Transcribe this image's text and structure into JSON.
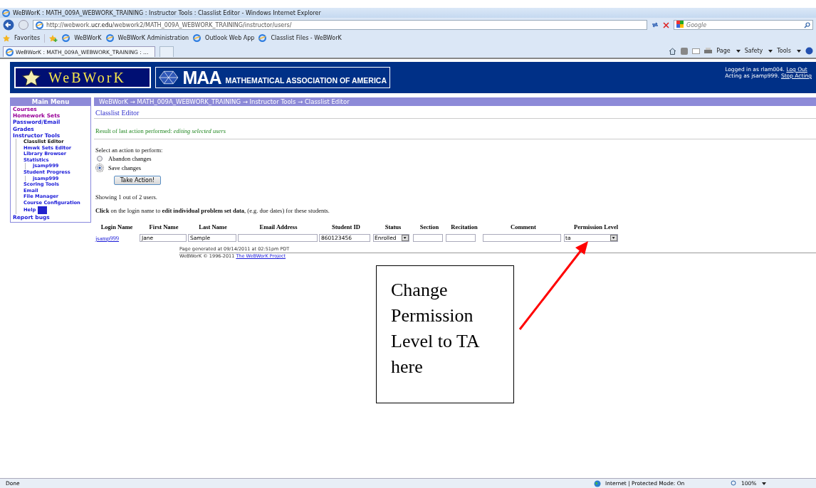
{
  "window": {
    "title": "WeBWorK : MATH_009A_WEBWORK_TRAINING : Instructor Tools : Classlist Editor - Windows Internet Explorer"
  },
  "address_bar": {
    "url_prefix": "http://webwork.",
    "url_host": "ucr.edu",
    "url_path": "/webwork2/MATH_009A_WEBWORK_TRAINING/instructor/users/",
    "search_placeholder": "Google"
  },
  "favorites": {
    "label": "Favorites",
    "links": [
      "WeBWorK",
      "WeBWorK Administration",
      "Outlook Web App",
      "Classlist Files - WeBWorK"
    ]
  },
  "tabs": [
    {
      "label": "WeBWorK : MATH_009A_WEBWORK_TRAINING : ...",
      "selected": true
    }
  ],
  "command_bar": [
    "Page",
    "Safety",
    "Tools"
  ],
  "banner": {
    "logo": "WeBWorK",
    "maa": "MAA",
    "maa_name": "MATHEMATICAL ASSOCIATION OF AMERICA",
    "login_text": "Logged in as rlam004.",
    "logout": "Log Out",
    "acting_text": "Acting as jsamp999.",
    "stop_acting": "Stop Acting"
  },
  "menu": {
    "title": "Main Menu",
    "items": [
      {
        "label": "Courses",
        "visited": true,
        "selected": false
      },
      {
        "label": "Homework Sets",
        "visited": true,
        "selected": false
      },
      {
        "label": "Password/Email",
        "visited": false,
        "selected": false
      },
      {
        "label": "Grades",
        "visited": false,
        "selected": false
      },
      {
        "label": "Instructor Tools",
        "visited": false,
        "selected": false,
        "children": [
          {
            "label": "Classlist Editor",
            "visited": false,
            "selected": true
          },
          {
            "label": "Hmwk Sets Editor",
            "visited": false,
            "selected": false
          },
          {
            "label": "Library Browser",
            "visited": false,
            "selected": false
          },
          {
            "label": "Statistics",
            "visited": false,
            "selected": false,
            "children": [
              {
                "label": "jsamp999",
                "visited": false,
                "selected": false
              }
            ]
          },
          {
            "label": "Student Progress",
            "visited": false,
            "selected": false,
            "children": [
              {
                "label": "jsamp999",
                "visited": false,
                "selected": false
              }
            ]
          },
          {
            "label": "Scoring Tools",
            "visited": false,
            "selected": false
          },
          {
            "label": "Email",
            "visited": false,
            "selected": false
          },
          {
            "label": "File Manager",
            "visited": false,
            "selected": false
          },
          {
            "label": "Course Configuration",
            "visited": false,
            "selected": false
          },
          {
            "label": "Help",
            "kind": "help",
            "visited": false,
            "selected": false
          }
        ]
      },
      {
        "label": "Report bugs",
        "visited": false,
        "selected": false
      }
    ]
  },
  "breadcrumb": "WeBWorK → MATH_009A_WEBWORK_TRAINING → Instructor Tools → Classlist Editor",
  "page_title": "Classlist Editor",
  "result_message": "Result of last action performed: *editing selected users*",
  "action": {
    "prompt": "Select an action to perform:",
    "options": [
      {
        "label": "Abandon changes",
        "selected": false
      },
      {
        "label": "Save changes",
        "selected": true
      }
    ],
    "button": "Take Action!"
  },
  "showing": "Showing 1 out of 2 users.",
  "instruction": "**Click** on the login name to **edit individual problem set data**, (e.g. due dates) for these students.",
  "table": {
    "columns": [
      "Login Name",
      "First Name",
      "Last Name",
      "Email Address",
      "Student ID",
      "Status",
      "Section",
      "Recitation",
      "Comment",
      "Permission Level"
    ],
    "rows": [
      {
        "login": "jsamp999",
        "first_name": "Jane",
        "last_name": "Sample",
        "student_id": "860123456",
        "status": "Enrolled",
        "permission": "ta"
      }
    ]
  },
  "footer": {
    "generated": "Page generated at 09/14/2011 at 02:51pm PDT",
    "copyright": "WeBWorK © 1996-2011",
    "project_link": "The WeBWorK Project"
  },
  "annotation": {
    "text": "Change Permission Level to TA here"
  },
  "status_bar": {
    "left": "Done",
    "zone": "Internet | Protected Mode: On",
    "zoom": "100%"
  }
}
